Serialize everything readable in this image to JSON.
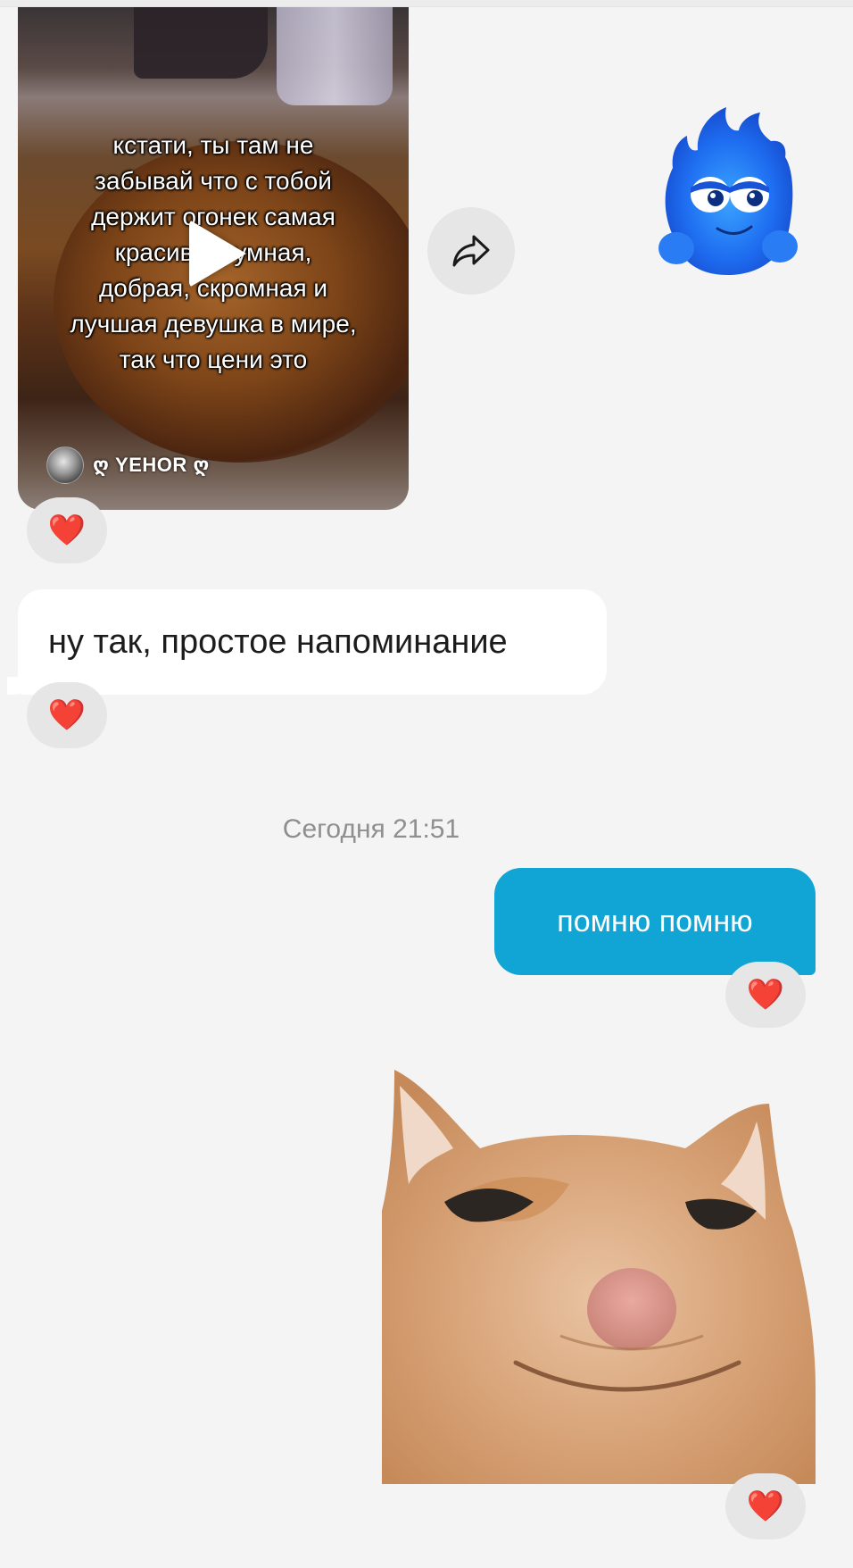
{
  "messages": {
    "video_post": {
      "overlay_text": "кстати, ты там не\nзабывай что с тобой\nдержит огонек самая\nкрасивая, умная,\nдобрая, скромная и\nлучшая девушка в мире,\nтак что цени это",
      "author": "ღ YEHOR ღ",
      "reaction": "❤️"
    },
    "fire_sticker": {
      "icon": "blue-fire-sticker-icon"
    },
    "incoming_text": {
      "text": "ну так, простое напоминание",
      "reaction": "❤️"
    },
    "timestamp": "Сегодня 21:51",
    "outgoing_text": {
      "text": "помню помню",
      "reaction": "❤️"
    },
    "cat_sticker": {
      "icon": "smiling-cat-sticker-icon",
      "reaction": "❤️"
    }
  },
  "colors": {
    "background": "#f4f4f4",
    "outgoing_bubble": "#10a5d4",
    "incoming_bubble": "#ffffff",
    "reaction_pill": "#e6e6e6",
    "heart": "#e0203a"
  }
}
